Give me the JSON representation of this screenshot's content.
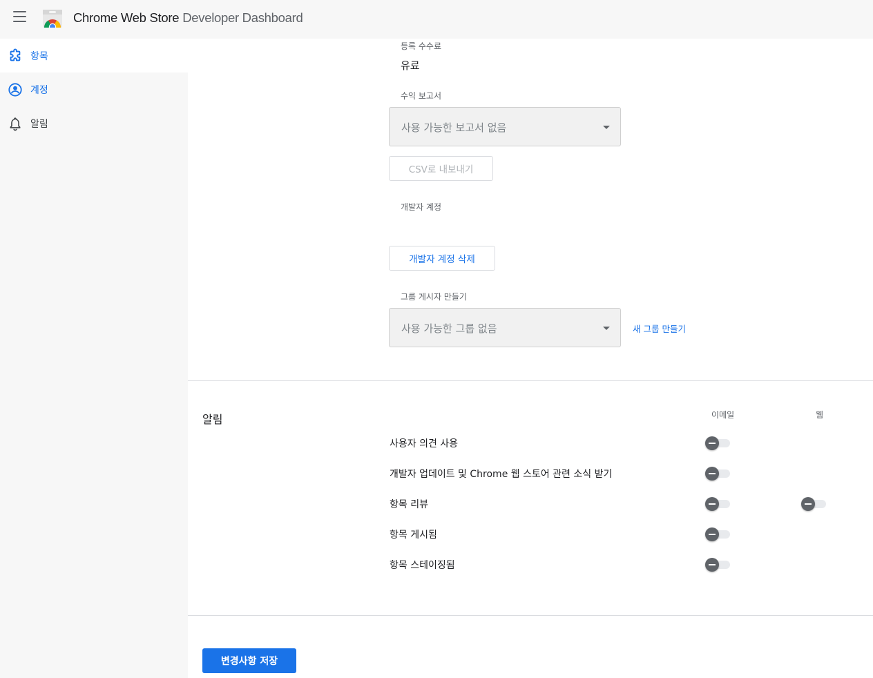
{
  "header": {
    "title_strong": "Chrome Web Store",
    "title_light": "Developer Dashboard"
  },
  "sidebar": {
    "items": [
      {
        "label": "항목",
        "icon": "puzzle-icon",
        "active": true
      },
      {
        "label": "계정",
        "icon": "account-circle-icon",
        "active": false
      },
      {
        "label": "알림",
        "icon": "bell-icon",
        "active": false
      }
    ]
  },
  "account": {
    "registration_fee_label": "등록 수수료",
    "registration_fee_value": "유료",
    "revenue_report_label": "수익 보고서",
    "revenue_report_select": "사용 가능한 보고서 없음",
    "export_csv_button": "CSV로 내보내기",
    "developer_account_label": "개발자 계정",
    "delete_account_button": "개발자 계정 삭제",
    "group_publisher_label": "그룹 게시자 만들기",
    "group_select": "사용 가능한 그룹 없음",
    "new_group_link": "새 그룹 만들기"
  },
  "notifications": {
    "title": "알림",
    "col_email": "이메일",
    "col_web": "웹",
    "rows": [
      {
        "label": "사용자 의견 사용",
        "email": false,
        "web": null
      },
      {
        "label": "개발자 업데이트 및 Chrome 웹 스토어 관련 소식 받기",
        "email": false,
        "web": null
      },
      {
        "label": "항목 리뷰",
        "email": false,
        "web": false
      },
      {
        "label": "항목 게시됨",
        "email": false,
        "web": null
      },
      {
        "label": "항목 스테이징됨",
        "email": false,
        "web": null
      }
    ]
  },
  "footer": {
    "save_button": "변경사항 저장"
  },
  "colors": {
    "accent": "#1a73e8",
    "header_bg": "#f7f7f7",
    "toggle_off": "#5f6368"
  }
}
